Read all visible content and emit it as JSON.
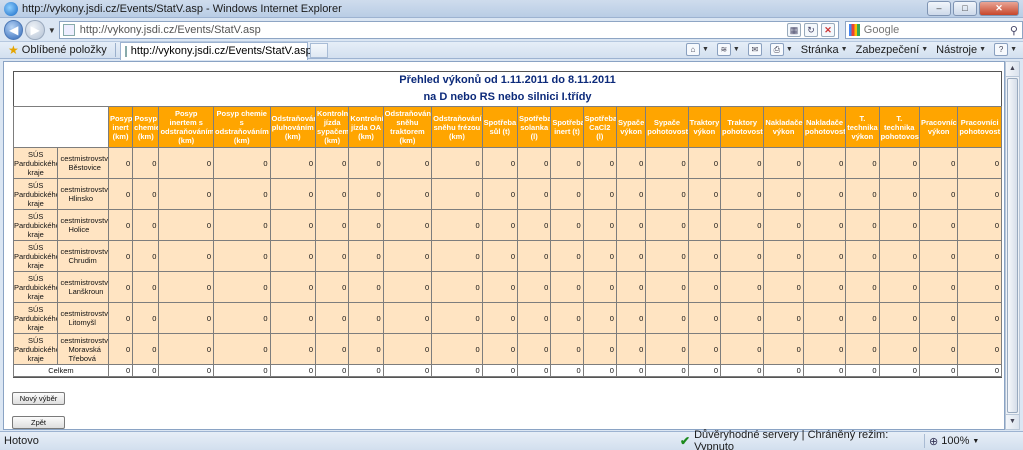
{
  "window": {
    "title": "http://vykony.jsdi.cz/Events/StatV.asp - Windows Internet Explorer",
    "minimize": "–",
    "maximize": "□",
    "close": "✕"
  },
  "address": {
    "url": "http://vykony.jsdi.cz/Events/StatV.asp",
    "search_placeholder": "Google"
  },
  "favorites": {
    "label": "Oblíbené položky",
    "tab_title": "http://vykony.jsdi.cz/Events/StatV.asp"
  },
  "command_bar": {
    "page": "Stránka",
    "security": "Zabezpečení",
    "tools": "Nástroje",
    "help": "?"
  },
  "report": {
    "title_line1": "Přehled výkonů od 1.11.2011 do 8.11.2011",
    "title_line2": "na D nebo RS nebo silnici I.třídy",
    "columns": [
      "Posyp inert (km)",
      "Posyp chemie (km)",
      "Posyp inertem s odstraňováním (km)",
      "Posyp chemie s odstraňováním (km)",
      "Odstraňování pluhováním (km)",
      "Kontrolní jízda sypačem (km)",
      "Kontrolní jízda OA (km)",
      "Odstraňování sněhu traktorem (km)",
      "Odstraňování sněhu frézou (km)",
      "Spotřeba sůl (t)",
      "Spotřeba solanka (l)",
      "Spotřeba inert (t)",
      "Spotřeba CaCl2 (l)",
      "Sypače výkon",
      "Sypače pohotovost",
      "Traktory výkon",
      "Traktory pohotovost",
      "Nakladače výkon",
      "Nakladače pohotovost",
      "T. technika výkon",
      "T. technika pohotovost",
      "Pracovníci výkon",
      "Pracovníci pohotovost"
    ],
    "rows": [
      {
        "org": [
          "SÚS",
          "Pardubického",
          "kraje"
        ],
        "district": [
          "cestmistrovství",
          "Běstovice"
        ],
        "values": [
          "0",
          "0",
          "0",
          "0",
          "0",
          "0",
          "0",
          "0",
          "0",
          "0",
          "0",
          "0",
          "0",
          "0",
          "0",
          "0",
          "0",
          "0",
          "0",
          "0",
          "0",
          "0",
          "0"
        ]
      },
      {
        "org": [
          "SÚS",
          "Pardubického",
          "kraje"
        ],
        "district": [
          "cestmistrovství",
          "Hlinsko"
        ],
        "values": [
          "0",
          "0",
          "0",
          "0",
          "0",
          "0",
          "0",
          "0",
          "0",
          "0",
          "0",
          "0",
          "0",
          "0",
          "0",
          "0",
          "0",
          "0",
          "0",
          "0",
          "0",
          "0",
          "0"
        ]
      },
      {
        "org": [
          "SÚS",
          "Pardubického",
          "kraje"
        ],
        "district": [
          "cestmistrovství",
          "Holice"
        ],
        "values": [
          "0",
          "0",
          "0",
          "0",
          "0",
          "0",
          "0",
          "0",
          "0",
          "0",
          "0",
          "0",
          "0",
          "0",
          "0",
          "0",
          "0",
          "0",
          "0",
          "0",
          "0",
          "0",
          "0"
        ]
      },
      {
        "org": [
          "SÚS",
          "Pardubického",
          "kraje"
        ],
        "district": [
          "cestmistrovství",
          "Chrudim"
        ],
        "values": [
          "0",
          "0",
          "0",
          "0",
          "0",
          "0",
          "0",
          "0",
          "0",
          "0",
          "0",
          "0",
          "0",
          "0",
          "0",
          "0",
          "0",
          "0",
          "0",
          "0",
          "0",
          "0",
          "0"
        ]
      },
      {
        "org": [
          "SÚS",
          "Pardubického",
          "kraje"
        ],
        "district": [
          "cestmistrovství",
          "Lanškroun"
        ],
        "values": [
          "0",
          "0",
          "0",
          "0",
          "0",
          "0",
          "0",
          "0",
          "0",
          "0",
          "0",
          "0",
          "0",
          "0",
          "0",
          "0",
          "0",
          "0",
          "0",
          "0",
          "0",
          "0",
          "0"
        ]
      },
      {
        "org": [
          "SÚS",
          "Pardubického",
          "kraje"
        ],
        "district": [
          "cestmistrovství",
          "Litomyšl"
        ],
        "values": [
          "0",
          "0",
          "0",
          "0",
          "0",
          "0",
          "0",
          "0",
          "0",
          "0",
          "0",
          "0",
          "0",
          "0",
          "0",
          "0",
          "0",
          "0",
          "0",
          "0",
          "0",
          "0",
          "0"
        ]
      },
      {
        "org": [
          "SÚS",
          "Pardubického",
          "kraje"
        ],
        "district": [
          "cestmistrovství",
          "Moravská",
          "Třebová"
        ],
        "values": [
          "0",
          "0",
          "0",
          "0",
          "0",
          "0",
          "0",
          "0",
          "0",
          "0",
          "0",
          "0",
          "0",
          "0",
          "0",
          "0",
          "0",
          "0",
          "0",
          "0",
          "0",
          "0",
          "0"
        ]
      }
    ],
    "total": {
      "label": "Celkem",
      "values": [
        "0",
        "0",
        "0",
        "0",
        "0",
        "0",
        "0",
        "0",
        "0",
        "0",
        "0",
        "0",
        "0",
        "0",
        "0",
        "0",
        "0",
        "0",
        "0",
        "0",
        "0",
        "0",
        "0"
      ]
    },
    "buttons": {
      "new_selection": "Nový výběr",
      "back": "Zpět"
    }
  },
  "status": {
    "text": "Hotovo",
    "zone": "Důvěryhodné servery | Chráněný režim: Vypnuto",
    "zoom": "100%"
  }
}
